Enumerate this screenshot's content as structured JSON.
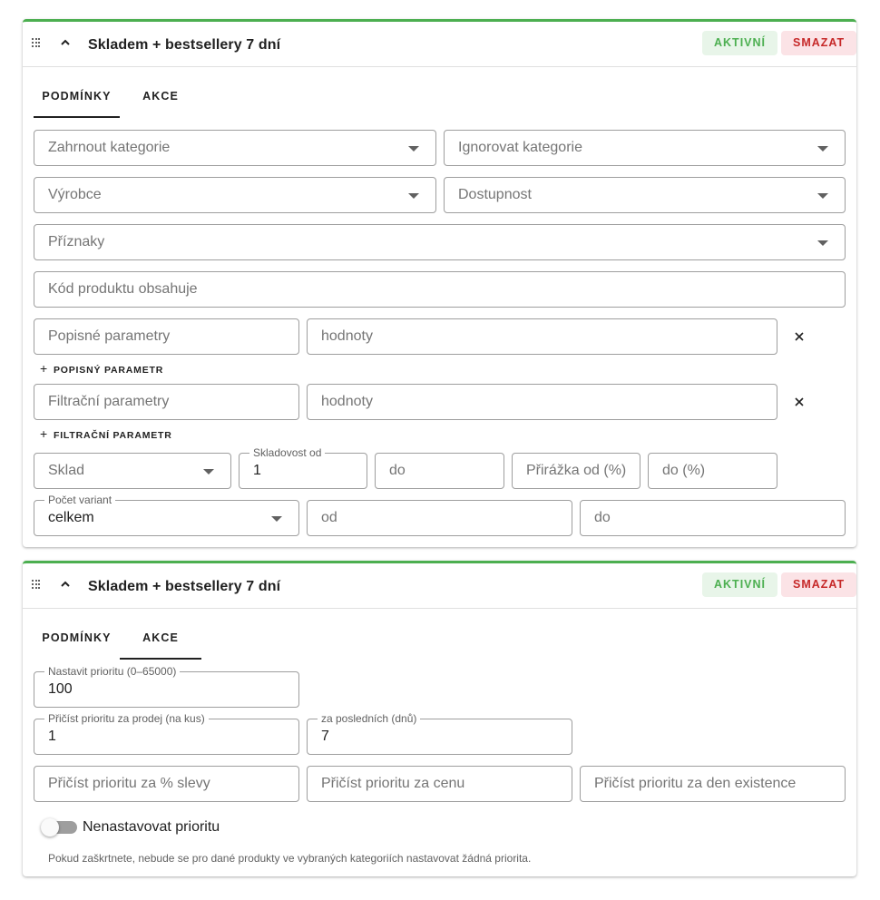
{
  "cards": [
    {
      "title": "Skladem + bestsellery 7 dní",
      "active_label": "AKTIVNÍ",
      "delete_label": "SMAZAT",
      "tabs": [
        {
          "label": "PODMÍNKY",
          "selected": true
        },
        {
          "label": "AKCE",
          "selected": false
        }
      ],
      "conditions": {
        "include_categories": {
          "placeholder": "Zahrnout kategorie"
        },
        "ignore_categories": {
          "placeholder": "Ignorovat kategorie"
        },
        "manufacturer": {
          "placeholder": "Výrobce"
        },
        "availability": {
          "placeholder": "Dostupnost"
        },
        "flags": {
          "placeholder": "Příznaky"
        },
        "product_code": {
          "placeholder": "Kód produktu obsahuje"
        },
        "descriptive_params": {
          "placeholder": "Popisné parametry"
        },
        "descriptive_values": {
          "placeholder": "hodnoty"
        },
        "add_descriptive": "POPISNÝ PARAMETR",
        "filter_params": {
          "placeholder": "Filtrační parametry"
        },
        "filter_values": {
          "placeholder": "hodnoty"
        },
        "add_filter": "FILTRAČNÍ PARAMETR",
        "warehouse": {
          "placeholder": "Sklad"
        },
        "stock_from": {
          "label": "Skladovost od",
          "value": "1"
        },
        "stock_to": {
          "placeholder": "do"
        },
        "markup_from": {
          "placeholder": "Přirážka od (%)"
        },
        "markup_to": {
          "placeholder": "do (%)"
        },
        "variant_count": {
          "label": "Počet variant",
          "value": "celkem"
        },
        "variant_from": {
          "placeholder": "od"
        },
        "variant_to": {
          "placeholder": "do"
        }
      }
    },
    {
      "title": "Skladem + bestsellery 7 dní",
      "active_label": "AKTIVNÍ",
      "delete_label": "SMAZAT",
      "tabs": [
        {
          "label": "PODMÍNKY",
          "selected": false
        },
        {
          "label": "AKCE",
          "selected": true
        }
      ],
      "actions": {
        "set_priority": {
          "label": "Nastavit prioritu (0–65000)",
          "value": "100"
        },
        "add_per_sale": {
          "label": "Přičíst prioritu za prodej (na kus)",
          "value": "1"
        },
        "last_days": {
          "label": "za posledních (dnů)",
          "value": "7"
        },
        "add_per_discount": {
          "placeholder": "Přičíst prioritu za % slevy"
        },
        "add_per_price": {
          "placeholder": "Přičíst prioritu za cenu"
        },
        "add_per_day": {
          "placeholder": "Přičíst prioritu za den existence"
        },
        "no_priority_label": "Nenastavovat prioritu",
        "no_priority_on": false,
        "hint": "Pokud zaškrtnete, nebude se pro dané produkty ve vybraných kategoriích nastavovat žádná priorita."
      }
    }
  ],
  "colors": {
    "accent": "#4caf50",
    "active_bg": "#e8f5e9",
    "delete_bg": "#fbe3e6",
    "delete_fg": "#c62828"
  }
}
